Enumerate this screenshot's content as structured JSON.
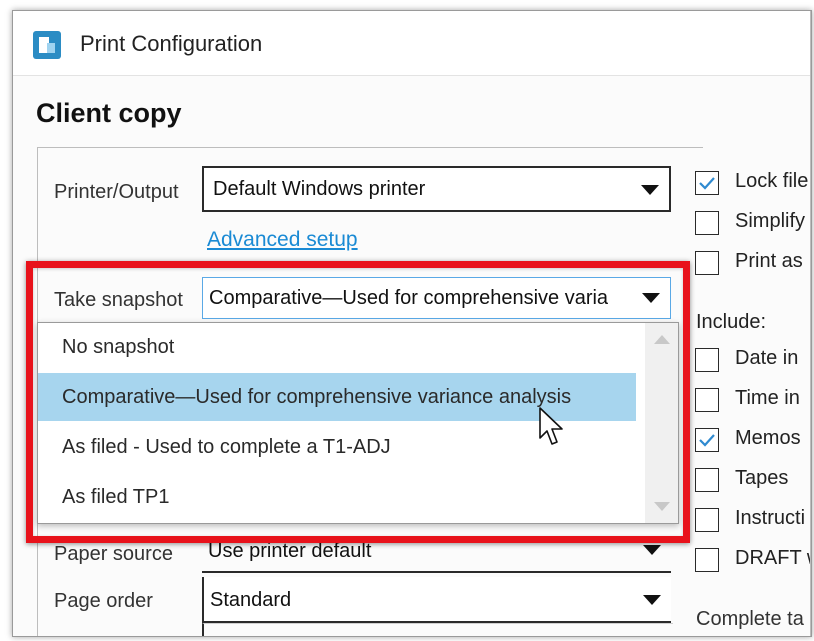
{
  "window": {
    "title": "Print Configuration",
    "icon": "app-logo-icon"
  },
  "section": {
    "heading": "Client copy"
  },
  "form": {
    "printer": {
      "label": "Printer/Output",
      "value": "Default Windows printer"
    },
    "advanced_setup": "Advanced setup",
    "snapshot": {
      "label": "Take snapshot",
      "value": "Comparative—Used for comprehensive varia"
    },
    "paper_source": {
      "label": "Paper source",
      "value": "Use printer default"
    },
    "page_order": {
      "label": "Page order",
      "value": "Standard"
    }
  },
  "dropdown": {
    "options": [
      {
        "label": "No snapshot",
        "selected": false
      },
      {
        "label": "Comparative—Used for comprehensive variance analysis",
        "selected": true
      },
      {
        "label": "As filed - Used to complete a T1-ADJ",
        "selected": false
      },
      {
        "label": "As filed TP1",
        "selected": false
      }
    ]
  },
  "options_column": {
    "lock": {
      "label": "Lock file",
      "checked": true
    },
    "simplify": {
      "label": "Simplify",
      "checked": false
    },
    "print_as": {
      "label": "Print as",
      "checked": false
    },
    "include_label": "Include:",
    "date": {
      "label": "Date in",
      "checked": false
    },
    "time": {
      "label": "Time in",
      "checked": false
    },
    "memos": {
      "label": "Memos",
      "checked": true
    },
    "tapes": {
      "label": "Tapes",
      "checked": false
    },
    "instructions": {
      "label": "Instructi",
      "checked": false
    },
    "draft": {
      "label": "DRAFT w",
      "checked": false
    },
    "complete_label": "Complete ta"
  },
  "colors": {
    "highlight": "#e8121b",
    "selection": "#a7d5ee",
    "link": "#1a8ad4",
    "checkmark": "#2f8ad0"
  }
}
